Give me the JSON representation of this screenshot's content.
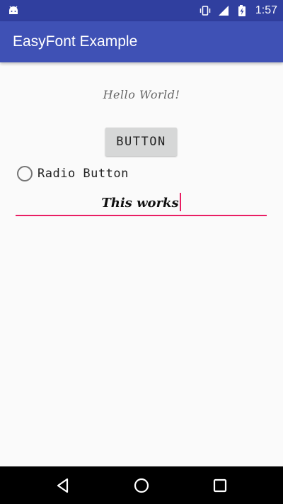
{
  "status_bar": {
    "time": "1:57",
    "icons": [
      "android-icon",
      "vibrate-icon",
      "signal-icon",
      "battery-charging-icon"
    ]
  },
  "app_bar": {
    "title": "EasyFont Example"
  },
  "content": {
    "hello_text": "Hello World!",
    "button_label": "BUTTON",
    "radio_label": "Radio Button",
    "edit_text_value": "This works"
  },
  "nav_bar": {
    "icons": [
      "back-icon",
      "home-icon",
      "recents-icon"
    ]
  },
  "colors": {
    "status_bar": "#303f9f",
    "app_bar": "#3f51b5",
    "accent": "#e91e63",
    "background": "#fafafa",
    "button_bg": "#d6d7d7"
  }
}
